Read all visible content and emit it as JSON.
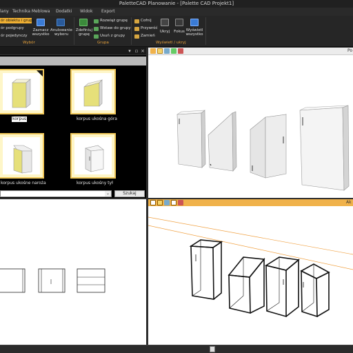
{
  "window": {
    "title": "PaletteCAD Planowanie - [Palette CAD Projekt1]"
  },
  "menu": {
    "items": [
      "lany",
      "Technika Meblowa",
      "Dodatki",
      "Widok",
      "Export"
    ]
  },
  "ribbon": {
    "selection": {
      "options": [
        "ór obiektu i grupy",
        "ór podgrupy",
        "ór pojedynczy"
      ],
      "select_all": [
        "Zaznacz",
        "wszystko"
      ],
      "cancel_selection": [
        "Anulowanie",
        "wyboru"
      ],
      "group_label": "Wybór"
    },
    "group": {
      "define": [
        "Zdefiniuj",
        "grupę"
      ],
      "items": [
        "Rozwiąż grupę",
        "Wstaw do grupy",
        "Usuń z grupy"
      ],
      "group_label": "Grupa"
    },
    "show_hide": {
      "items": [
        "Cofnij",
        "Przywróć",
        "Zamień"
      ],
      "hide": "Ukryj",
      "focus": "Fokus",
      "show_all": [
        "Wyświetl",
        "wszystko"
      ],
      "group_label": "Wyświetl / ukryj"
    }
  },
  "catalog": {
    "items": [
      {
        "label": "korpus",
        "selected": true
      },
      {
        "label": "korpus ukośna góra",
        "selected": false
      },
      {
        "label": "korpus ukośne naroża",
        "selected": false
      },
      {
        "label": "korpus ukośny tył",
        "selected": false
      }
    ],
    "search_button": "Szukaj",
    "header_buttons": [
      "close-icon",
      "maximize-icon",
      "close-icon"
    ]
  },
  "viewports": {
    "top_right_label": "Po",
    "bottom_right_label": "Ak"
  },
  "status": {
    "center_icon": "calculator-icon"
  }
}
